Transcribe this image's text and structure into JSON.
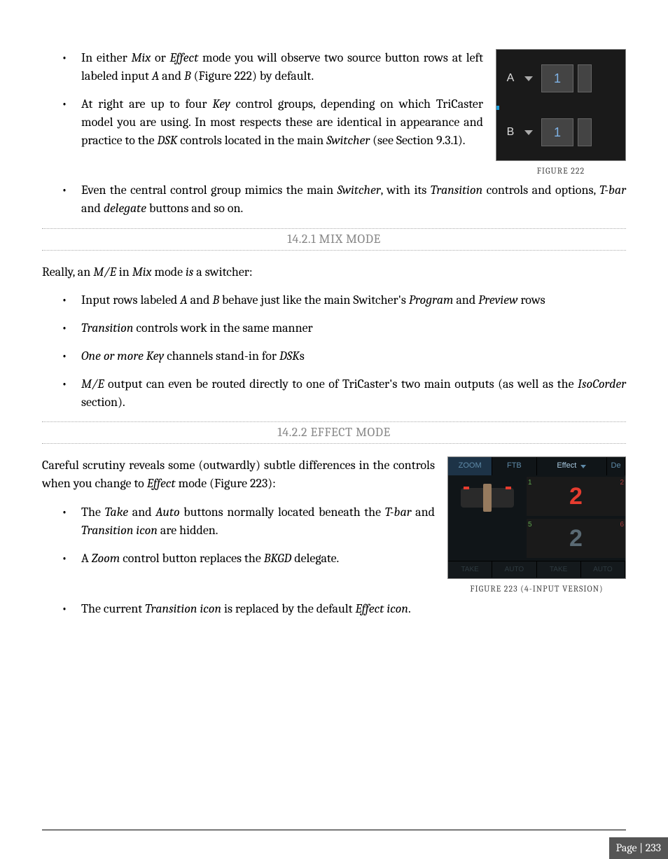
{
  "bullets1": {
    "b1_pre": "In either ",
    "b1_em1": "Mix",
    "b1_mid1": " or ",
    "b1_em2": "Effect",
    "b1_mid2": " mode you will observe two source button rows at left labeled input ",
    "b1_em3": "A",
    "b1_mid3": " and ",
    "b1_em4": "B",
    "b1_post": " (Figure 222) by default.",
    "b2_pre": "At right are up to four ",
    "b2_em1": "Key",
    "b2_mid1": " control groups, depending on which TriCaster model you are using.  In most respects these are identical in appearance and practice to the ",
    "b2_em2": "DSK",
    "b2_mid2": " controls located in the main ",
    "b2_em3": "Switcher",
    "b2_post": " (see Section 9.3.1).",
    "b3_pre": "Even the central control group mimics the main ",
    "b3_em1": "Switcher",
    "b3_mid1": ", with its ",
    "b3_em2": "Transition",
    "b3_mid2": " controls and options, ",
    "b3_em3": "T-bar",
    "b3_mid3": " and ",
    "b3_em4": "delegate",
    "b3_post": " buttons and so on."
  },
  "fig222": {
    "labelA": "A",
    "labelB": "B",
    "btn": "1",
    "caption": "FIGURE 222"
  },
  "heading1": "14.2.1 MIX MODE",
  "para1": {
    "pre": "Really, an ",
    "em1": "M/E",
    "mid1": " in ",
    "em2": "Mix",
    "mid2": " mode ",
    "em3": "is",
    "post": " a switcher:"
  },
  "bullets2": {
    "b1_pre": "Input rows labeled ",
    "b1_em1": "A",
    "b1_mid1": " and ",
    "b1_em2": "B",
    "b1_mid2": " behave just like the main Switcher's ",
    "b1_em3": "Program",
    "b1_mid3": " and ",
    "b1_em4": "Preview",
    "b1_post": " rows",
    "b2_em1": "Transition",
    "b2_post": " controls work in the same manner",
    "b3_em1": "One or more Key",
    "b3_mid1": " channels stand-in for ",
    "b3_em2": "DSK",
    "b3_post": "s",
    "b4_em1": "M/E",
    "b4_mid1": " output can even be routed directly to one of TriCaster's two main outputs (as well as the ",
    "b4_em2": "IsoCorder",
    "b4_post": " section)."
  },
  "heading2": "14.2.2 EFFECT MODE",
  "para2": {
    "pre": "Careful scrutiny reveals some (outwardly) subtle differences in the controls when you change to ",
    "em1": "Effect",
    "post": " mode (Figure 223):"
  },
  "bullets3": {
    "b1_pre": "The ",
    "b1_em1": "Take",
    "b1_mid1": " and ",
    "b1_em2": "Auto",
    "b1_mid2": " buttons normally located beneath the ",
    "b1_em3": "T-bar",
    "b1_mid3": " and ",
    "b1_em4": "Transition icon",
    "b1_post": " are hidden.",
    "b2_pre": "A ",
    "b2_em1": "Zoom",
    "b2_mid1": " control button replaces the ",
    "b2_em2": "BKGD",
    "b2_post": " delegate.",
    "b3_pre": "The current ",
    "b3_em1": "Transition icon",
    "b3_mid1": " is replaced by the default ",
    "b3_em2": "Effect icon",
    "b3_post": "."
  },
  "fig223": {
    "tab_zoom": "ZOOM",
    "tab_ftb": "FTB",
    "tab_effect": "Effect",
    "tab_de": "De",
    "num1": "2",
    "num2": "2",
    "c1": "1",
    "c2": "2",
    "c3": "5",
    "c4": "6",
    "take": "TAKE",
    "auto": "AUTO",
    "caption": "FIGURE 223 (4-INPUT VERSION)"
  },
  "footer": {
    "page": "Page | 233"
  }
}
